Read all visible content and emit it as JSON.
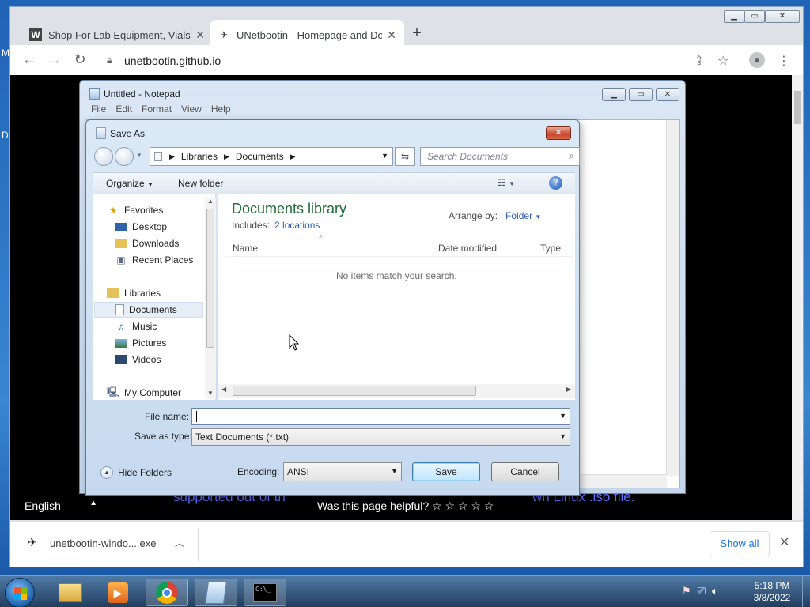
{
  "browser": {
    "tabs": [
      {
        "label": "Shop For Lab Equipment, Vials, C",
        "favicon": "W"
      },
      {
        "label": "UNetbootin - Homepage and Do"
      }
    ],
    "url": "unetbootin.github.io",
    "language": "English",
    "helpful_text": "Was this page helpful? ☆ ☆ ☆ ☆ ☆",
    "bg_text_left": "supported out of th",
    "bg_text_right": "wn Linux .iso file.",
    "download": {
      "filename": "unetbootin-windo....exe",
      "show_all": "Show all"
    },
    "edge_fragments": [
      "M",
      "D"
    ]
  },
  "notepad": {
    "title": "Untitled - Notepad",
    "menu": [
      "File",
      "Edit",
      "Format",
      "View",
      "Help"
    ]
  },
  "save_dialog": {
    "title": "Save As",
    "breadcrumb": [
      "Libraries",
      "Documents"
    ],
    "search_placeholder": "Search Documents",
    "organize": "Organize",
    "new_folder": "New folder",
    "nav": {
      "favorites": "Favorites",
      "desktop": "Desktop",
      "downloads": "Downloads",
      "recent": "Recent Places",
      "libraries": "Libraries",
      "documents": "Documents",
      "music": "Music",
      "pictures": "Pictures",
      "videos": "Videos",
      "computer": "My Computer"
    },
    "library_title": "Documents library",
    "includes_label": "Includes:",
    "includes_link": "2 locations",
    "arrange_label": "Arrange by:",
    "arrange_value": "Folder",
    "columns": [
      "Name",
      "Date modified",
      "Type"
    ],
    "empty_message": "No items match your search.",
    "file_name_label": "File name:",
    "file_name_value": "",
    "save_type_label": "Save as type:",
    "save_type_value": "Text Documents (*.txt)",
    "hide_folders": "Hide Folders",
    "encoding_label": "Encoding:",
    "encoding_value": "ANSI",
    "save": "Save",
    "cancel": "Cancel"
  },
  "taskbar": {
    "time": "5:18 PM",
    "date": "3/8/2022"
  }
}
